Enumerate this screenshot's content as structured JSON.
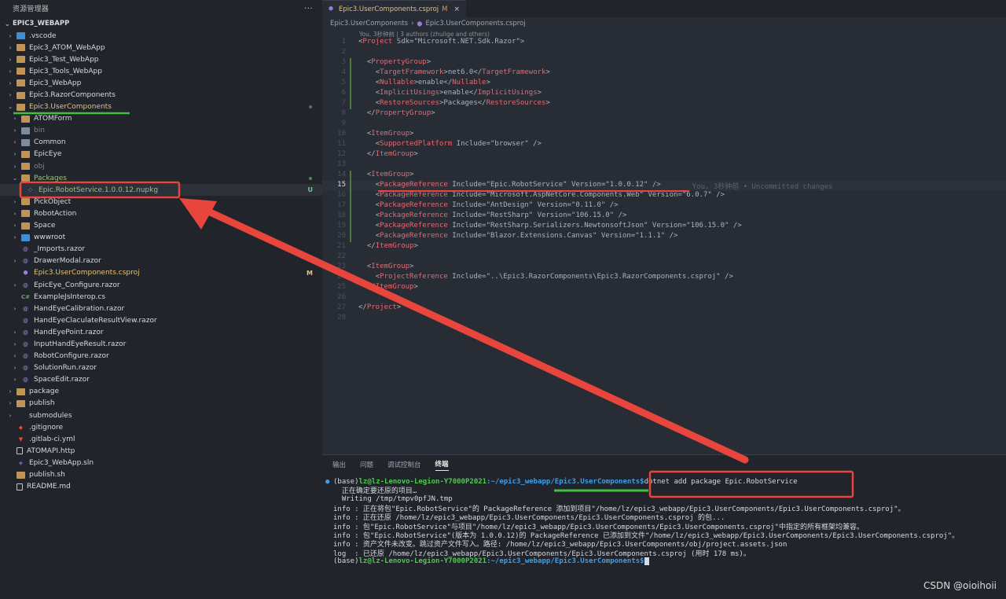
{
  "sidebar": {
    "title": "资源管理器",
    "more": "···",
    "section": "EPIC3_WEBAPP",
    "items": [
      {
        "label": ".vscode",
        "chev": "›",
        "icon": "vscode-folder-icon",
        "cls": "ico-vscode",
        "depth": 1
      },
      {
        "label": "Epic3_ATOM_WebApp",
        "chev": "›",
        "icon": "folder-icon",
        "cls": "ico-folder",
        "depth": 1
      },
      {
        "label": "Epic3_Test_WebApp",
        "chev": "›",
        "icon": "folder-icon",
        "cls": "ico-folder",
        "depth": 1
      },
      {
        "label": "Epic3_Tools_WebApp",
        "chev": "›",
        "icon": "folder-icon",
        "cls": "ico-folder",
        "depth": 1
      },
      {
        "label": "Epic3_WebApp",
        "chev": "›",
        "icon": "folder-icon",
        "cls": "ico-folder",
        "depth": 1
      },
      {
        "label": "Epic3.RazorComponents",
        "chev": "›",
        "icon": "folder-icon",
        "cls": "ico-folder",
        "depth": 1
      },
      {
        "label": "Epic3.UserComponents",
        "chev": "⌄",
        "icon": "folder-open-icon",
        "cls": "ico-folder",
        "depth": 1,
        "color": "#e5c07b",
        "dot": "#6a6a5a"
      },
      {
        "label": "ATOMForm",
        "chev": "›",
        "icon": "folder-icon",
        "cls": "ico-folder",
        "depth": 2
      },
      {
        "label": "bin",
        "chev": "›",
        "icon": "folder-icon",
        "cls": "ico-folder-special",
        "depth": 2,
        "color": "#7f848e"
      },
      {
        "label": "Common",
        "chev": "›",
        "icon": "folder-icon",
        "cls": "ico-folder-special",
        "depth": 2
      },
      {
        "label": "EpicEye",
        "chev": "›",
        "icon": "folder-icon",
        "cls": "ico-folder",
        "depth": 2
      },
      {
        "label": "obj",
        "chev": "›",
        "icon": "folder-icon",
        "cls": "ico-folder",
        "depth": 2,
        "color": "#7f848e"
      },
      {
        "label": "Packages",
        "chev": "⌄",
        "icon": "folder-open-icon",
        "cls": "ico-folder",
        "depth": 2,
        "color": "#98c379",
        "dot": "#4b8b4b"
      },
      {
        "label": "Epic.RobotService.1.0.0.12.nupkg",
        "chev": "",
        "icon": "nuget-package-icon",
        "cls": "ico-pkg",
        "glyph": "⁘",
        "depth": 3,
        "color": "#98c379",
        "badge": "U",
        "badgeColor": "#73c991",
        "selected": true
      },
      {
        "label": "PickObject",
        "chev": "›",
        "icon": "folder-icon",
        "cls": "ico-folder",
        "depth": 2
      },
      {
        "label": "RobotAction",
        "chev": "›",
        "icon": "folder-icon",
        "cls": "ico-folder",
        "depth": 2
      },
      {
        "label": "Space",
        "chev": "›",
        "icon": "folder-icon",
        "cls": "ico-folder",
        "depth": 2
      },
      {
        "label": "wwwroot",
        "chev": "›",
        "icon": "web-folder-icon",
        "cls": "ico-vscode",
        "depth": 2
      },
      {
        "label": "_Imports.razor",
        "chev": "",
        "icon": "razor-file-icon",
        "cls": "ico-razor",
        "glyph": "@",
        "depth": 2
      },
      {
        "label": "DrawerModal.razor",
        "chev": "›",
        "icon": "razor-file-icon",
        "cls": "ico-razor",
        "glyph": "@",
        "depth": 2
      },
      {
        "label": "Epic3.UserComponents.csproj",
        "chev": "",
        "icon": "csproj-file-icon",
        "cls": "ico-csproj",
        "glyph": "⬢",
        "depth": 2,
        "color": "#e5c07b",
        "badge": "M",
        "badgeColor": "#e2c08d"
      },
      {
        "label": "EpicEye_Configure.razor",
        "chev": "›",
        "icon": "razor-file-icon",
        "cls": "ico-razor",
        "glyph": "@",
        "depth": 2
      },
      {
        "label": "ExampleJsInterop.cs",
        "chev": "",
        "icon": "csharp-file-icon",
        "cls": "ico-cs",
        "glyph": "C#",
        "depth": 2
      },
      {
        "label": "HandEyeCalibration.razor",
        "chev": "›",
        "icon": "razor-file-icon",
        "cls": "ico-razor",
        "glyph": "@",
        "depth": 2
      },
      {
        "label": "HandEyeClaculateResultView.razor",
        "chev": "",
        "icon": "razor-file-icon",
        "cls": "ico-razor",
        "glyph": "@",
        "depth": 2
      },
      {
        "label": "HandEyePoint.razor",
        "chev": "›",
        "icon": "razor-file-icon",
        "cls": "ico-razor",
        "glyph": "@",
        "depth": 2
      },
      {
        "label": "InputHandEyeResult.razor",
        "chev": "›",
        "icon": "razor-file-icon",
        "cls": "ico-razor",
        "glyph": "@",
        "depth": 2
      },
      {
        "label": "RobotConfigure.razor",
        "chev": "›",
        "icon": "razor-file-icon",
        "cls": "ico-razor",
        "glyph": "@",
        "depth": 2
      },
      {
        "label": "SolutionRun.razor",
        "chev": "›",
        "icon": "razor-file-icon",
        "cls": "ico-razor",
        "glyph": "@",
        "depth": 2
      },
      {
        "label": "SpaceEdit.razor",
        "chev": "›",
        "icon": "razor-file-icon",
        "cls": "ico-razor",
        "glyph": "@",
        "depth": 2
      },
      {
        "label": "package",
        "chev": "›",
        "icon": "package-folder-icon",
        "cls": "ico-folder",
        "depth": 1
      },
      {
        "label": "publish",
        "chev": "›",
        "icon": "folder-icon",
        "cls": "ico-folder",
        "depth": 1
      },
      {
        "label": "submodules",
        "chev": "›",
        "icon": "folder-icon",
        "cls": "ico-git",
        "depth": 1
      },
      {
        "label": ".gitignore",
        "chev": "",
        "icon": "git-file-icon",
        "cls": "ico-git",
        "glyph": "◆",
        "depth": 1
      },
      {
        "label": ".gitlab-ci.yml",
        "chev": "",
        "icon": "gitlab-file-icon",
        "cls": "ico-git",
        "glyph": "▼",
        "depth": 1
      },
      {
        "label": "ATOMAPI.http",
        "chev": "",
        "icon": "file-icon",
        "cls": "ico-file",
        "depth": 1
      },
      {
        "label": "Epic3_WebApp.sln",
        "chev": "",
        "icon": "solution-file-icon",
        "cls": "ico-sln",
        "glyph": "◈",
        "depth": 1
      },
      {
        "label": "publish.sh",
        "chev": "",
        "icon": "shell-file-icon",
        "cls": "ico-folder",
        "glyph": "",
        "depth": 1
      },
      {
        "label": "README.md",
        "chev": "",
        "icon": "markdown-file-icon",
        "cls": "ico-file",
        "depth": 1
      }
    ]
  },
  "editor": {
    "tab_label": "Epic3.UserComponents.csproj",
    "tab_modified": "M",
    "tab_close": "×",
    "breadcrumb_root": "Epic3.UserComponents",
    "breadcrumb_sep": "›",
    "breadcrumb_file": "Epic3.UserComponents.csproj",
    "blame": "You, 3秒钟前 | 3 authors (zhulige and others)",
    "current_line": 15,
    "inline_blame": "You, 3秒钟前 • Uncommitted changes",
    "lines": [
      "<Project Sdk=\"Microsoft.NET.Sdk.Razor\">",
      "",
      "  <PropertyGroup>",
      "    <TargetFramework>net6.0</TargetFramework>",
      "    <Nullable>enable</Nullable>",
      "    <ImplicitUsings>enable</ImplicitUsings>",
      "    <RestoreSources>Packages</RestoreSources>",
      "  </PropertyGroup>",
      "",
      "  <ItemGroup>",
      "    <SupportedPlatform Include=\"browser\" />",
      "  </ItemGroup>",
      "",
      "  <ItemGroup>",
      "    <PackageReference Include=\"Epic.RobotService\" Version=\"1.0.0.12\" />",
      "    <PackageReference Include=\"Microsoft.AspNetCore.Components.Web\" Version=\"6.0.7\" />",
      "    <PackageReference Include=\"AntDesign\" Version=\"0.11.0\" />",
      "    <PackageReference Include=\"RestSharp\" Version=\"106.15.0\" />",
      "    <PackageReference Include=\"RestSharp.Serializers.NewtonsoftJson\" Version=\"106.15.0\" />",
      "    <PackageReference Include=\"Blazor.Extensions.Canvas\" Version=\"1.1.1\" />",
      "  </ItemGroup>",
      "",
      "  <ItemGroup>",
      "    <ProjectReference Include=\"..\\Epic3.RazorComponents\\Epic3.RazorComponents.csproj\" />",
      "  </ItemGroup>",
      "",
      "</Project>",
      ""
    ],
    "modified_lines": [
      3,
      4,
      5,
      6,
      7,
      14,
      15,
      16,
      17,
      18,
      19,
      20
    ]
  },
  "panel": {
    "tabs": [
      "输出",
      "问题",
      "调试控制台",
      "终端"
    ],
    "active_tab": "终端",
    "prompt_env": "(base)",
    "prompt_user": "lz@lz-Lenovo-Legion-Y7000P2021",
    "prompt_path": ":~/epic3_webapp/Epic3.UserComponents$",
    "command": "dotnet add package Epic.RobotService",
    "output": [
      "  正在确定要还原的项目…",
      "  Writing /tmp/tmpv0pfJN.tmp",
      "info : 正在将包\"Epic.RobotService\"的 PackageReference 添加到项目\"/home/lz/epic3_webapp/Epic3.UserComponents/Epic3.UserComponents.csproj\"。",
      "info : 正在还原 /home/lz/epic3_webapp/Epic3.UserComponents/Epic3.UserComponents.csproj 的包...",
      "info : 包\"Epic.RobotService\"与项目\"/home/lz/epic3_webapp/Epic3.UserComponents/Epic3.UserComponents.csproj\"中指定的所有框架均兼容。",
      "info : 包\"Epic.RobotService\"(版本为 1.0.0.12)的 PackageReference 已添加到文件\"/home/lz/epic3_webapp/Epic3.UserComponents/Epic3.UserComponents.csproj\"。",
      "info : 资产文件未改变。跳过资产文件写入。路径: /home/lz/epic3_webapp/Epic3.UserComponents/obj/project.assets.json",
      "log  : 已还原 /home/lz/epic3_webapp/Epic3.UserComponents/Epic3.UserComponents.csproj (用时 178 ms)。"
    ]
  },
  "watermark": "CSDN @oioihoii",
  "colors": {
    "annotation_red": "#e8453c",
    "annotation_green": "#3cc23c"
  }
}
